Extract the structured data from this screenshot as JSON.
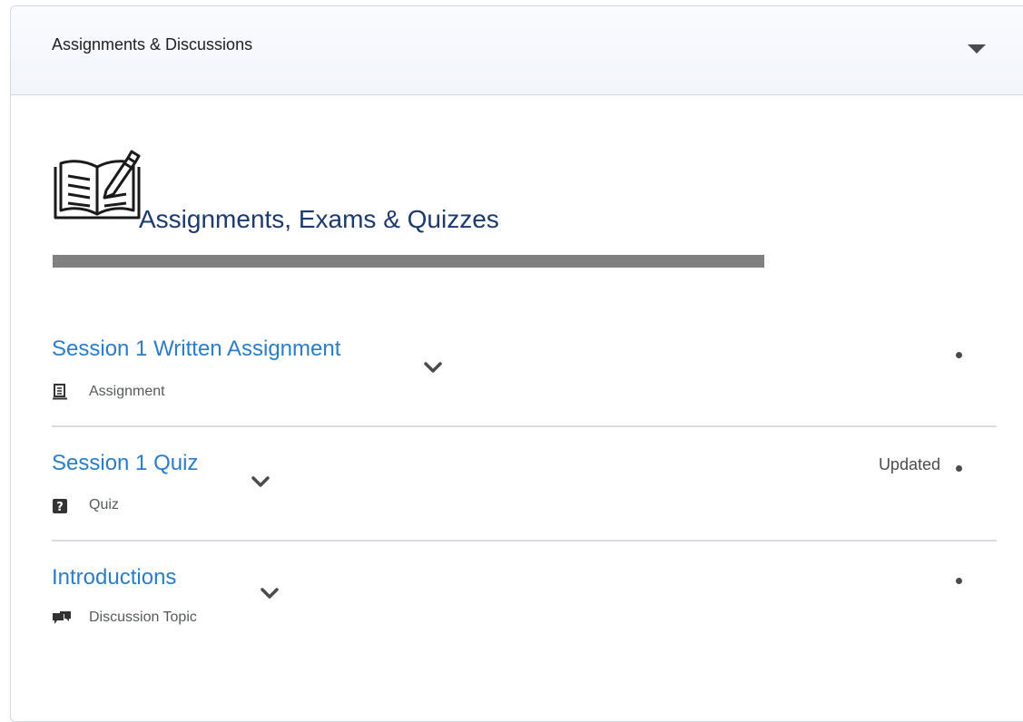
{
  "panel": {
    "title": "Assignments & Discussions"
  },
  "hero": {
    "icon": "book-pencil-icon",
    "title": "Assignments, Exams & Quizzes"
  },
  "items": [
    {
      "title": "Session 1 Written Assignment",
      "type": "Assignment",
      "type_icon": "assignment-icon",
      "status": ""
    },
    {
      "title": "Session 1 Quiz",
      "type": "Quiz",
      "type_icon": "quiz-icon",
      "status": "Updated"
    },
    {
      "title": "Introductions",
      "type": "Discussion Topic",
      "type_icon": "discussion-icon",
      "status": ""
    }
  ],
  "colors": {
    "link": "#2a7dc6",
    "hero_title": "#1c3a6e",
    "hero_bar": "#808080",
    "text": "#494c4e"
  }
}
